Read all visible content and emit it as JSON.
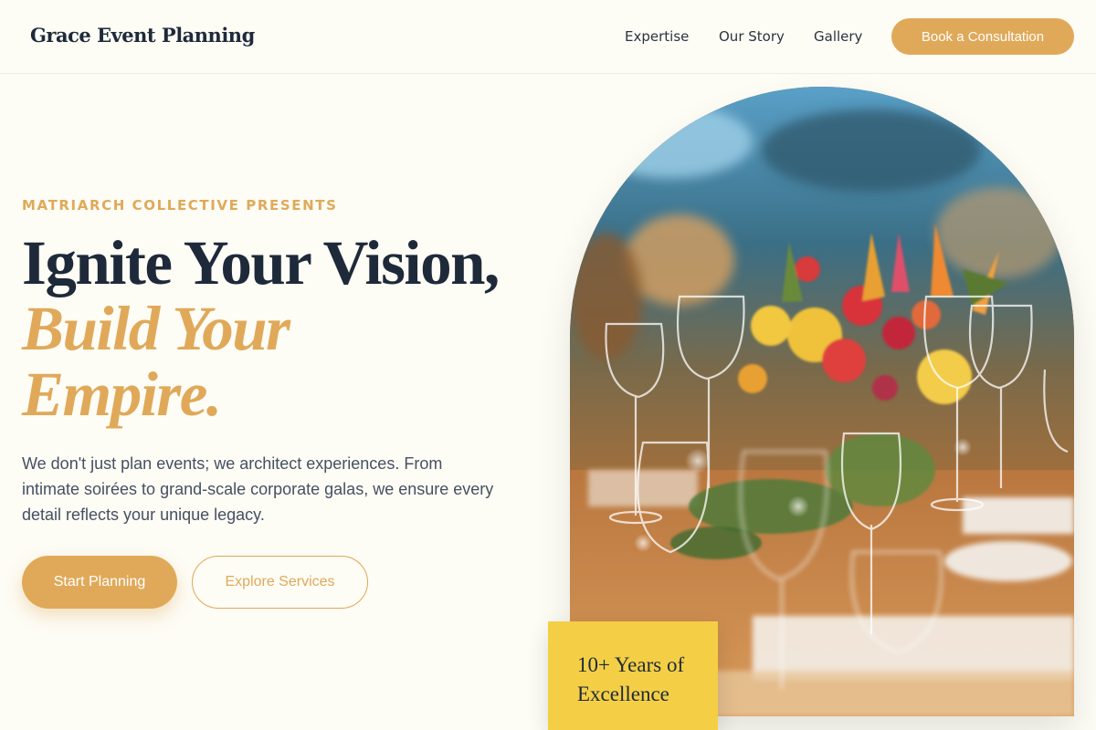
{
  "header": {
    "brand": "Grace Event Planning",
    "nav": [
      "Expertise",
      "Our Story",
      "Gallery"
    ],
    "cta_label": "Book a Consultation"
  },
  "hero": {
    "eyebrow": "MATRIARCH COLLECTIVE PRESENTS",
    "headline_line1": "Ignite Your Vision,",
    "headline_line2": "Build Your",
    "headline_line3": "Empire.",
    "lead": "We don't just plan events; we architect experiences. From intimate soirées to grand-scale corporate galas, we ensure every detail reflects your unique legacy.",
    "primary_button": "Start Planning",
    "secondary_button": "Explore Services"
  },
  "badge": {
    "line1": "10+ Years of",
    "line2": "Excellence"
  },
  "colors": {
    "accent": "#e0a959",
    "badge": "#f4cf45",
    "navy": "#1e2a3a",
    "background": "#fdfcf5"
  }
}
